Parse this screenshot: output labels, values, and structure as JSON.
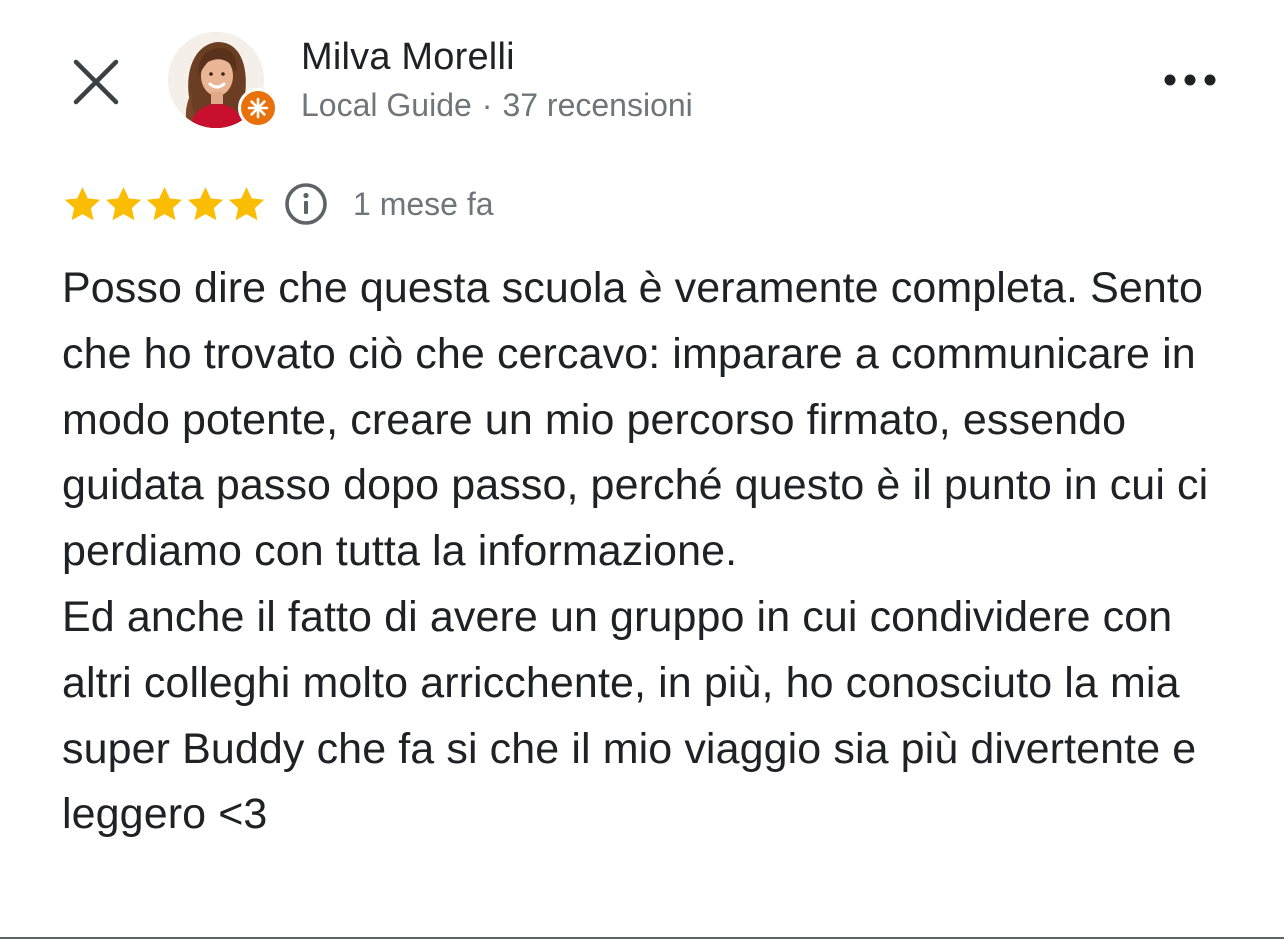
{
  "reviewer": {
    "name": "Milva Morelli",
    "badge": "Local Guide",
    "separator": "·",
    "review_count": "37 recensioni",
    "avatar_icon": "person-photo",
    "badge_color": "#e8710a"
  },
  "review": {
    "rating": 5,
    "max_rating": 5,
    "date": "1 mese fa",
    "star_color": "#fbbc04",
    "text": "Posso dire che questa scuola è veramente completa. Sento che ho trovato ciò che cercavo: imparare a communicare in modo potente, creare un mio percorso firmato, essendo guidata passo dopo passo, perché questo è il punto in cui ci perdiamo con tutta la informazione.\nEd anche il fatto di avere un gruppo in cui condividere con altri colleghi molto arricchente, in più, ho conosciuto la mia super Buddy che fa si che il mio viaggio sia più divertente e leggero <3"
  },
  "icons": {
    "close": "close-icon",
    "more": "more-horizontal-icon",
    "info": "info-icon",
    "star": "star-icon"
  },
  "colors": {
    "primary_text": "#202124",
    "secondary_text": "#70757a",
    "icon": "#3c4043"
  }
}
